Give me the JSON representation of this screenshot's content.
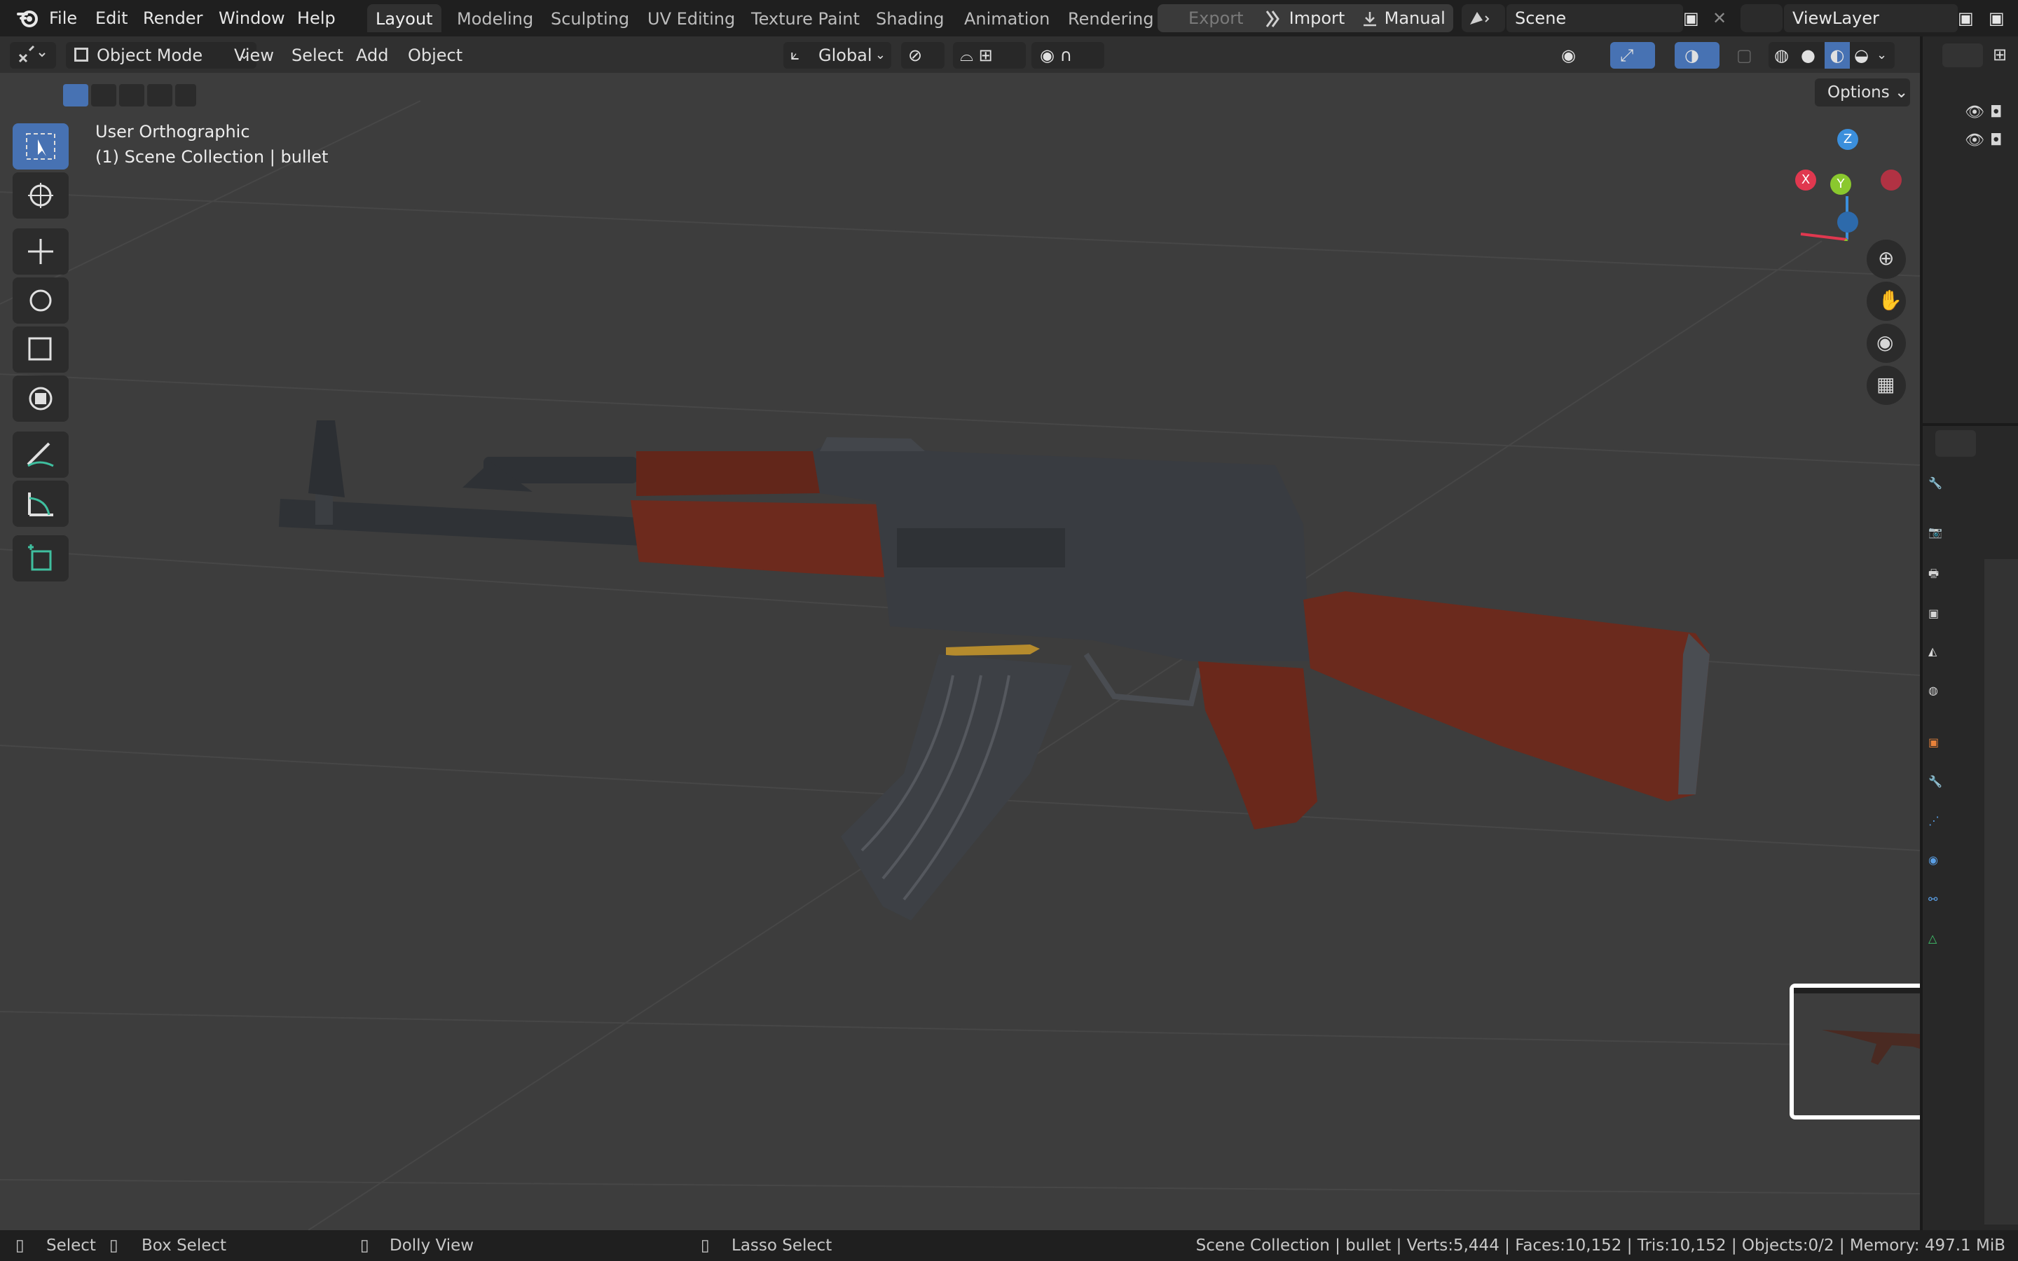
{
  "menu": {
    "file": "File",
    "edit": "Edit",
    "render": "Render",
    "window": "Window",
    "help": "Help"
  },
  "workspaces": [
    "Layout",
    "Modeling",
    "Sculpting",
    "UV Editing",
    "Texture Paint",
    "Shading",
    "Animation",
    "Rendering"
  ],
  "topbar": {
    "export": "Export",
    "import": "Import",
    "manual": "Manual",
    "scene": "Scene",
    "view_layer": "ViewLayer"
  },
  "header": {
    "mode": "Object Mode",
    "view": "View",
    "select": "Select",
    "add": "Add",
    "object": "Object",
    "orientation": "Global",
    "options": "Options"
  },
  "overlay": {
    "view_name": "User Orthographic",
    "collection": "(1) Scene Collection | bullet"
  },
  "gizmo": {
    "x": "X",
    "y": "Y",
    "z": "Z"
  },
  "status": {
    "select": "Select",
    "box_select": "Box Select",
    "dolly": "Dolly View",
    "lasso": "Lasso Select",
    "stats": "Scene Collection | bullet | Verts:5,444 | Faces:10,152 | Tris:10,152 | Objects:0/2 | Memory: 497.1 MiB"
  },
  "colors": {
    "accent": "#4772b3",
    "x_axis": "#e0384f",
    "y_axis": "#8ac82e",
    "z_axis": "#3b8fdc",
    "wood": "#6a2a1c",
    "metal": "#3a3c40"
  }
}
